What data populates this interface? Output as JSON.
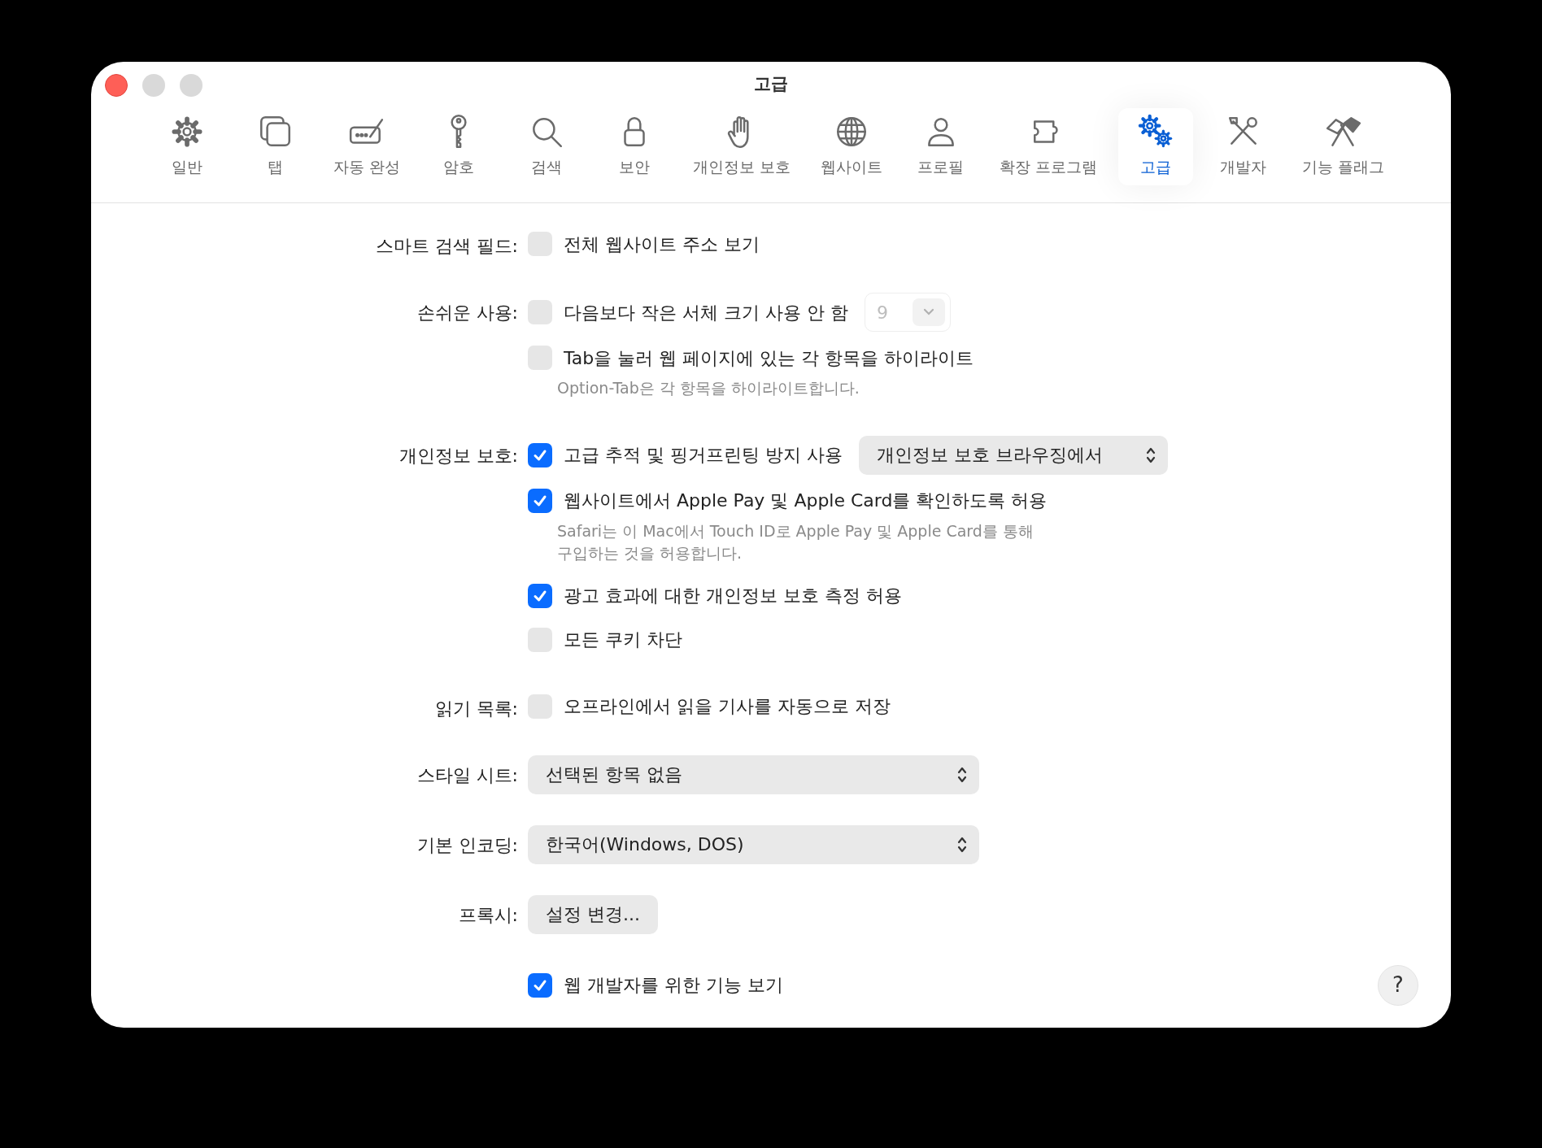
{
  "window": {
    "title": "고급"
  },
  "tabs": [
    {
      "label": "일반",
      "selected": false
    },
    {
      "label": "탭",
      "selected": false
    },
    {
      "label": "자동 완성",
      "selected": false
    },
    {
      "label": "암호",
      "selected": false
    },
    {
      "label": "검색",
      "selected": false
    },
    {
      "label": "보안",
      "selected": false
    },
    {
      "label": "개인정보 보호",
      "selected": false
    },
    {
      "label": "웹사이트",
      "selected": false
    },
    {
      "label": "프로필",
      "selected": false
    },
    {
      "label": "확장 프로그램",
      "selected": false
    },
    {
      "label": "고급",
      "selected": true
    },
    {
      "label": "개발자",
      "selected": false
    },
    {
      "label": "기능 플래그",
      "selected": false
    }
  ],
  "sections": [
    {
      "label": "스마트 검색 필드:",
      "items": [
        {
          "kind": "checkbox",
          "label": "전체 웹사이트 주소 보기",
          "checked": false
        }
      ]
    },
    {
      "label": "손쉬운 사용:",
      "items": [
        {
          "kind": "checkbox",
          "label": "다음보다 작은 서체 크기 사용 안 함",
          "checked": false,
          "select": {
            "kind": "small",
            "value": "9",
            "disabled": true
          }
        },
        {
          "kind": "checkbox",
          "label": "Tab을 눌러 웹 페이지에 있는 각 항목을 하이라이트",
          "checked": false,
          "note": "Option-Tab은 각 항목을 하이라이트합니다."
        }
      ]
    },
    {
      "label": "개인정보 보호:",
      "items": [
        {
          "kind": "checkbox",
          "label": "고급 추적 및 핑거프린팅 방지 사용",
          "checked": true,
          "select": {
            "kind": "popup",
            "value": "개인정보 보호 브라우징에서",
            "disabled": false
          }
        },
        {
          "kind": "checkbox",
          "label": "웹사이트에서 Apple Pay 및 Apple Card를 확인하도록 허용",
          "checked": true,
          "note": "Safari는 이 Mac에서 Touch ID로 Apple Pay 및 Apple Card를 통해\n구입하는 것을 허용합니다."
        },
        {
          "kind": "checkbox",
          "label": "광고 효과에 대한 개인정보 보호 측정 허용",
          "checked": true
        },
        {
          "kind": "checkbox",
          "label": "모든 쿠키 차단",
          "checked": false
        }
      ]
    },
    {
      "label": "읽기 목록:",
      "items": [
        {
          "kind": "checkbox",
          "label": "오프라인에서 읽을 기사를 자동으로 저장",
          "checked": false
        }
      ]
    },
    {
      "label": "스타일 시트:",
      "items": [
        {
          "kind": "popup",
          "value": "선택된 항목 없음"
        }
      ]
    },
    {
      "label": "기본 인코딩:",
      "items": [
        {
          "kind": "popup",
          "value": "한국어(Windows, DOS)"
        }
      ]
    },
    {
      "label": "프록시:",
      "items": [
        {
          "kind": "button",
          "label": "설정 변경..."
        }
      ]
    },
    {
      "items": [
        {
          "kind": "checkbox",
          "label": "웹 개발자를 위한 기능 보기",
          "checked": true
        }
      ]
    }
  ],
  "help_button": {
    "label": "?"
  }
}
